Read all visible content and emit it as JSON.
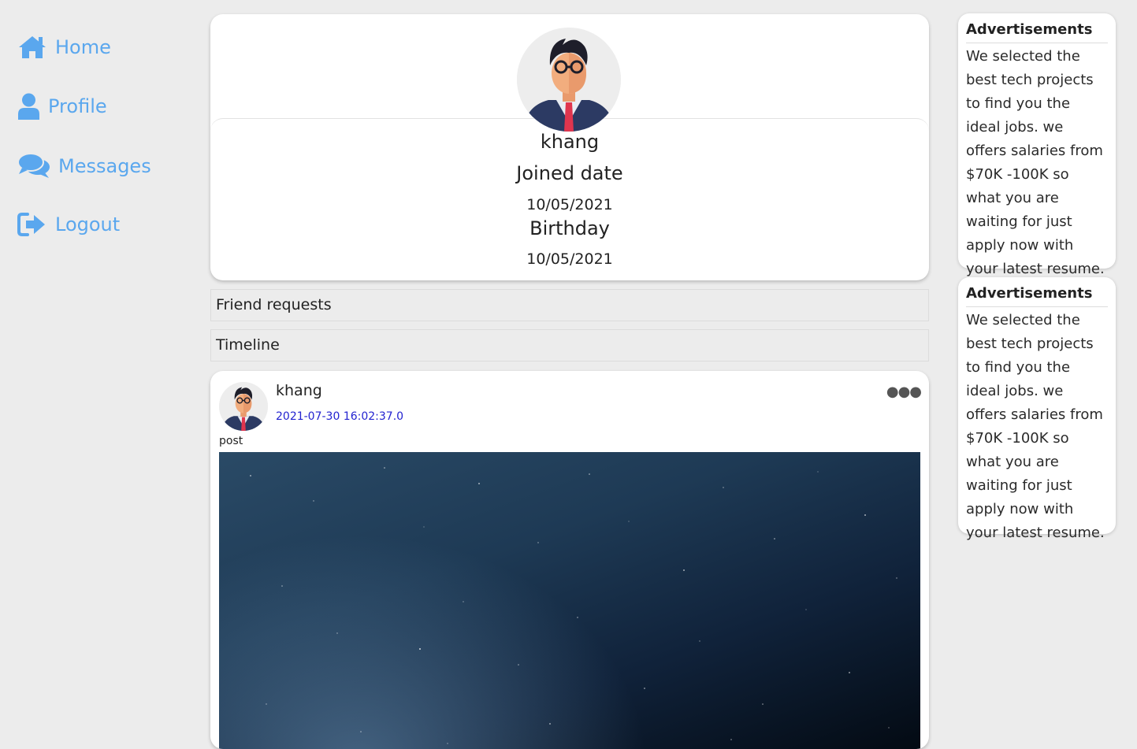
{
  "sidebar": {
    "items": [
      {
        "label": "Home",
        "icon": "home-icon"
      },
      {
        "label": "Profile",
        "icon": "user-icon"
      },
      {
        "label": "Messages",
        "icon": "comments-icon"
      },
      {
        "label": "Logout",
        "icon": "sign-out-icon"
      }
    ],
    "accent_color": "#5aa7ee"
  },
  "profile": {
    "name": "khang",
    "joined_label": "Joined date",
    "joined_value": "10/05/2021",
    "birthday_label": "Birthday",
    "birthday_value": "10/05/2021"
  },
  "sections": {
    "friend_requests": "Friend requests",
    "timeline": "Timeline"
  },
  "post": {
    "author": "khang",
    "timestamp": "2021-07-30 16:02:37.0",
    "text": "post",
    "menu_icon": "more-horizontal-icon"
  },
  "ads": [
    {
      "title": "Advertisements",
      "body": "We selected the best tech projects to find you the ideal jobs. we offers salaries from $70K -100K so what you are waiting for just apply now with your latest resume."
    },
    {
      "title": "Advertisements",
      "body": "We selected the best tech projects to find you the ideal jobs. we offers salaries from $70K -100K so what you are waiting for just apply now with your latest resume."
    }
  ]
}
